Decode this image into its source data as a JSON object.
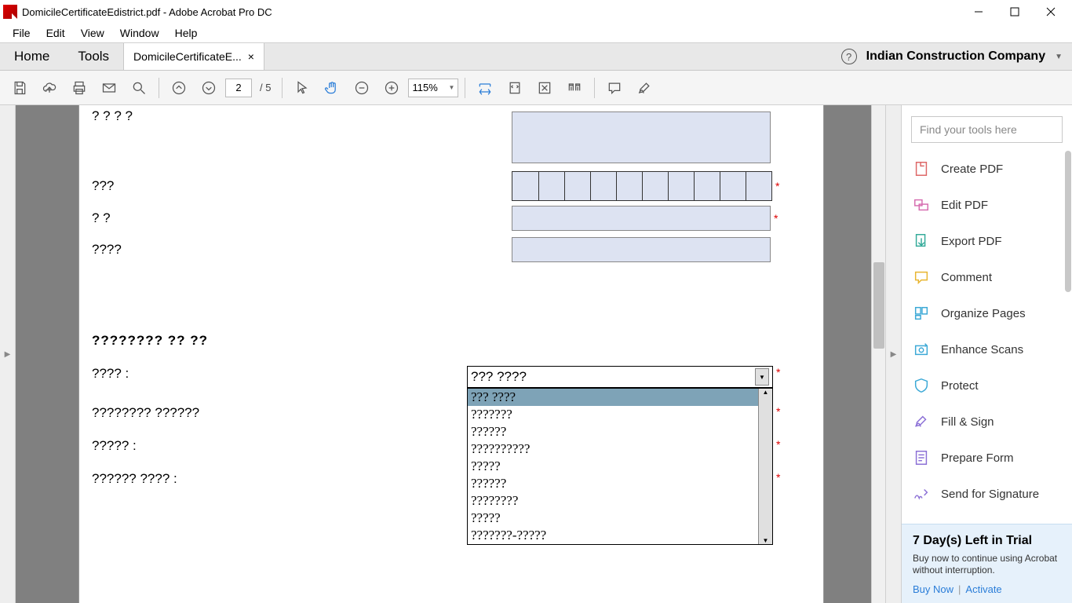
{
  "window": {
    "title": "DomicileCertificateEdistrict.pdf - Adobe Acrobat Pro DC"
  },
  "menu": {
    "items": [
      "File",
      "Edit",
      "View",
      "Window",
      "Help"
    ]
  },
  "tabs": {
    "home": "Home",
    "tools": "Tools",
    "doc": "DomicileCertificateE...",
    "company": "Indian Construction Company"
  },
  "toolbar": {
    "page_current": "2",
    "page_total": "/ 5",
    "zoom": "115%"
  },
  "form": {
    "labels": {
      "l1": "? ? ? ?",
      "l2": "???",
      "l3": "? ?",
      "l4": "????",
      "section": "???????? ?? ??",
      "l5": "???? :",
      "l6": "???????? ??????",
      "l7": "????? :",
      "l8": "?????? ???? :"
    },
    "dd_selected": "??? ????",
    "dd_options": [
      "??? ????",
      "???????",
      "??????",
      "??????????",
      "?????",
      "??????",
      "????????",
      "?????",
      "???????-?????"
    ]
  },
  "rpane": {
    "search_placeholder": "Find your tools here",
    "tools": [
      "Create PDF",
      "Edit PDF",
      "Export PDF",
      "Comment",
      "Organize Pages",
      "Enhance Scans",
      "Protect",
      "Fill & Sign",
      "Prepare Form",
      "Send for Signature"
    ],
    "trial_title": "7 Day(s) Left in Trial",
    "trial_sub": "Buy now to continue using Acrobat without interruption.",
    "buy": "Buy Now",
    "activate": "Activate"
  },
  "colors": {
    "accent": "#2a7dd8"
  }
}
